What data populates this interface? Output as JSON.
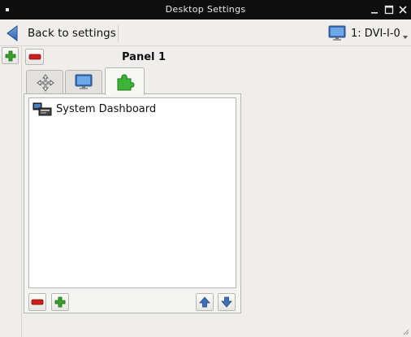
{
  "window": {
    "title": "Desktop Settings",
    "controls": [
      "minimize-icon",
      "maximize-icon",
      "close-icon"
    ]
  },
  "toolbar": {
    "back_label": "Back to settings",
    "output_label": "1: DVI-I-0"
  },
  "panel": {
    "title": "Panel 1",
    "tabs": [
      {
        "icon": "move-arrows-icon",
        "selected": false
      },
      {
        "icon": "monitor-icon",
        "selected": false
      },
      {
        "icon": "puzzle-piece-icon",
        "selected": true
      }
    ],
    "items": [
      {
        "label": "System Dashboard",
        "icon": "system-dashboard-icon"
      }
    ]
  },
  "colors": {
    "titlebar": "#0f0f0f",
    "window_bg": "#efeeec",
    "add_green": "#3aa02c",
    "remove_red": "#c8221e",
    "arrow_blue": "#3d6fb5"
  }
}
